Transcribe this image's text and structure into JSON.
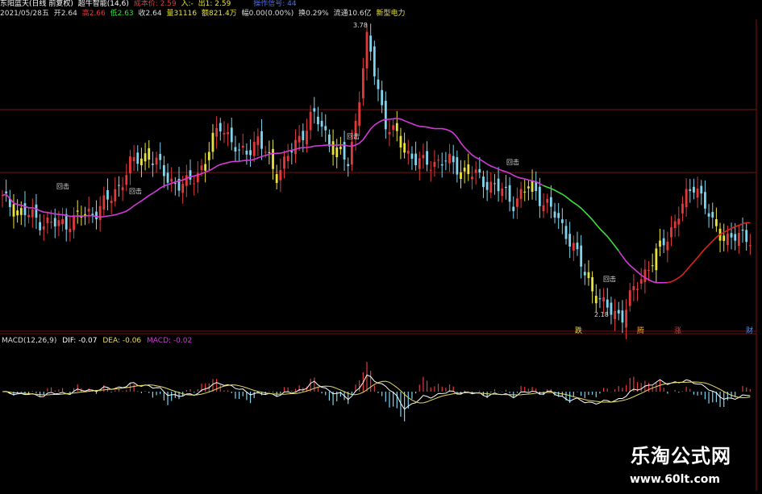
{
  "header": {
    "stock_name": "东阳蓝天(日线 前复权)",
    "indicator": "超牛智能(14,6)",
    "cost_label": "成本价: 2.59",
    "entry_label": "入:-",
    "exit_label": "出1: 2.59",
    "extra_label": "操作信号: 44",
    "date": "2021/05/28",
    "weekday": "五",
    "open": "开2.64",
    "high": "高2.66",
    "low": "低2.63",
    "close": "收2.64",
    "volume": "量31116",
    "amount": "额821.4万",
    "change": "幅0.00(0.00%)",
    "turnover": "换0.29%",
    "float": "流通10.6亿",
    "concept": "新型电力"
  },
  "colors": {
    "up": "#e23a3a",
    "down": "#7fd4ee",
    "yellow": "#e8e23a",
    "ma_magenta": "#d13ad6",
    "ma_red": "#e02020",
    "ma_green": "#3adf3a",
    "hline": "#7a1010",
    "dif": "#ffffff",
    "dea": "#e8dc6a",
    "macd_label": "#d13ad6",
    "watermark": "#ffffff"
  },
  "annotations": {
    "high_label": "3.78",
    "low_label": "2.18",
    "callback_label": "回击"
  },
  "markers": [
    "跌",
    "腾",
    "涨",
    "财"
  ],
  "macd": {
    "label": "MACD(12,26,9)",
    "dif": "DIF: -0.07",
    "dea": "DEA: -0.06",
    "macd": "MACD: -0.02"
  },
  "watermark": {
    "cn": "乐淘公式网",
    "url": "www.60lt.com"
  },
  "chart_data": [
    {
      "type": "candlestick",
      "title": "东阳蓝天(日线 前复权)",
      "ylim": [
        2.1,
        3.85
      ],
      "high_point": 3.78,
      "low_point": 2.18,
      "close_last": 2.64,
      "ma_label": "成本线",
      "description_values": [
        2.85,
        2.78,
        2.73,
        2.7,
        2.74,
        2.78,
        2.86,
        3.05,
        3.12,
        2.98,
        2.92,
        3.05,
        3.3,
        3.1,
        3.2,
        3.0,
        3.15,
        3.35,
        3.18,
        3.05,
        3.78,
        3.3,
        3.15,
        3.05,
        3.08,
        3.04,
        2.98,
        2.93,
        2.84,
        2.93,
        2.8,
        2.65,
        2.4,
        2.22,
        2.18,
        2.4,
        2.55,
        2.75,
        2.96,
        2.68,
        2.62,
        2.64
      ]
    },
    {
      "type": "bar",
      "title": "MACD(12,26,9)",
      "series": [
        {
          "name": "DIF",
          "values": [
            -0.07
          ]
        },
        {
          "name": "DEA",
          "values": [
            -0.06
          ]
        },
        {
          "name": "MACD",
          "values": [
            -0.02
          ]
        }
      ]
    }
  ]
}
